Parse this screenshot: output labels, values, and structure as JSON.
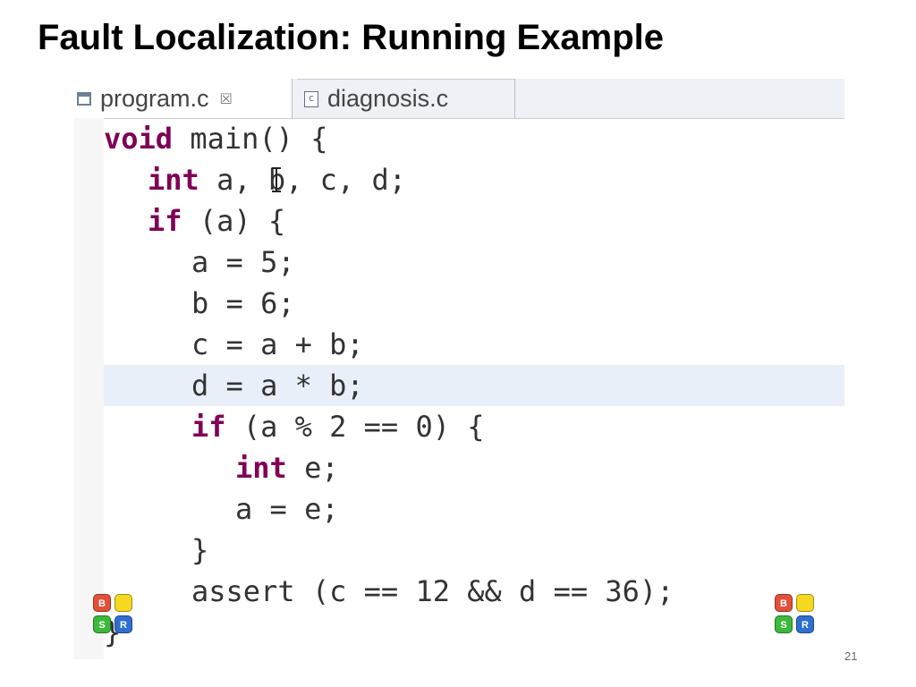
{
  "slide": {
    "title": "Fault Localization: Running Example",
    "page_number": "21"
  },
  "editor": {
    "tabs": [
      {
        "label": "program.c",
        "active": true,
        "icon": "editor-tab-icon",
        "close_glyph": "☒"
      },
      {
        "label": "diagnosis.c",
        "active": false,
        "icon": "c-file-icon",
        "icon_glyph": "c"
      }
    ],
    "colors": {
      "keyword": "#7f0055",
      "text": "#333333",
      "highlight_line": "#e9eff9",
      "tab_bar": "#eef1f6"
    },
    "code_lines": [
      {
        "indent": 0,
        "keyword": "void",
        "rest": " main() {"
      },
      {
        "indent": 1,
        "keyword": "int",
        "rest": " a, b, c, d;"
      },
      {
        "indent": 1,
        "keyword": "if",
        "rest": " (a) {"
      },
      {
        "indent": 2,
        "keyword": "",
        "rest": "a = 5;"
      },
      {
        "indent": 2,
        "keyword": "",
        "rest": "b = 6;"
      },
      {
        "indent": 2,
        "keyword": "",
        "rest": "c = a + b;"
      },
      {
        "indent": 2,
        "keyword": "",
        "rest": "d = a * b;",
        "highlighted": true
      },
      {
        "indent": 2,
        "keyword": "if",
        "rest": " (a % 2 == 0) {"
      },
      {
        "indent": 3,
        "keyword": "int",
        "rest": " e;"
      },
      {
        "indent": 3,
        "keyword": "",
        "rest": "a = e;"
      },
      {
        "indent": 2,
        "keyword": "",
        "rest": "}"
      },
      {
        "indent": 2,
        "keyword": "",
        "rest": "assert (c == 12 && d == 36);"
      },
      {
        "indent": 0,
        "keyword": "",
        "rest": "}"
      }
    ],
    "logo_badges": {
      "icon": "bugassist-logo-icon",
      "tiles": [
        {
          "letter": "B",
          "color": "#e3503a"
        },
        {
          "letter": "",
          "color": "#f5d820"
        },
        {
          "letter": "S",
          "color": "#3cb83a"
        },
        {
          "letter": "R",
          "color": "#2e6fd0"
        }
      ]
    }
  }
}
